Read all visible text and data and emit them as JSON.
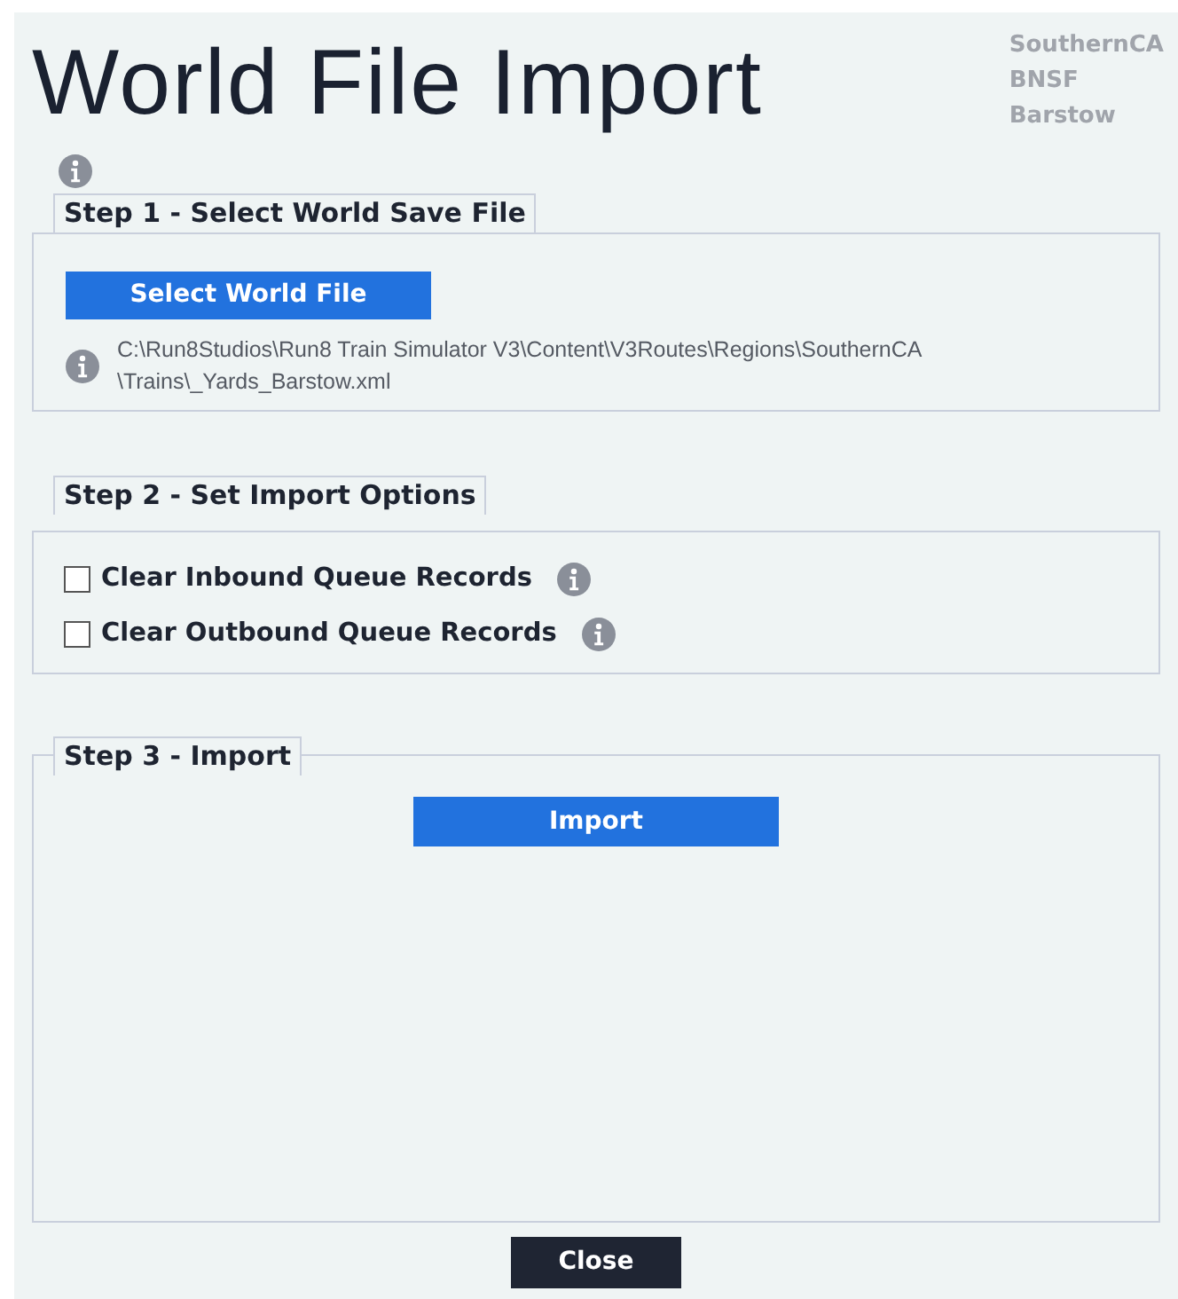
{
  "title": "World File Import",
  "route_info": [
    "SouthernCA",
    "BNSF",
    "Barstow"
  ],
  "step1": {
    "legend": "Step 1 - Select World Save File",
    "button": "Select World File",
    "path": "C:\\Run8Studios\\Run8 Train Simulator V3\\Content\\V3Routes\\Regions\\SouthernCA \\Trains\\_Yards_Barstow.xml"
  },
  "step2": {
    "legend": "Step 2 - Set Import Options",
    "options": [
      {
        "label": "Clear Inbound Queue Records",
        "checked": false
      },
      {
        "label": "Clear Outbound Queue Records",
        "checked": false
      }
    ]
  },
  "step3": {
    "legend": "Step 3 - Import",
    "button": "Import"
  },
  "close_button": "Close"
}
